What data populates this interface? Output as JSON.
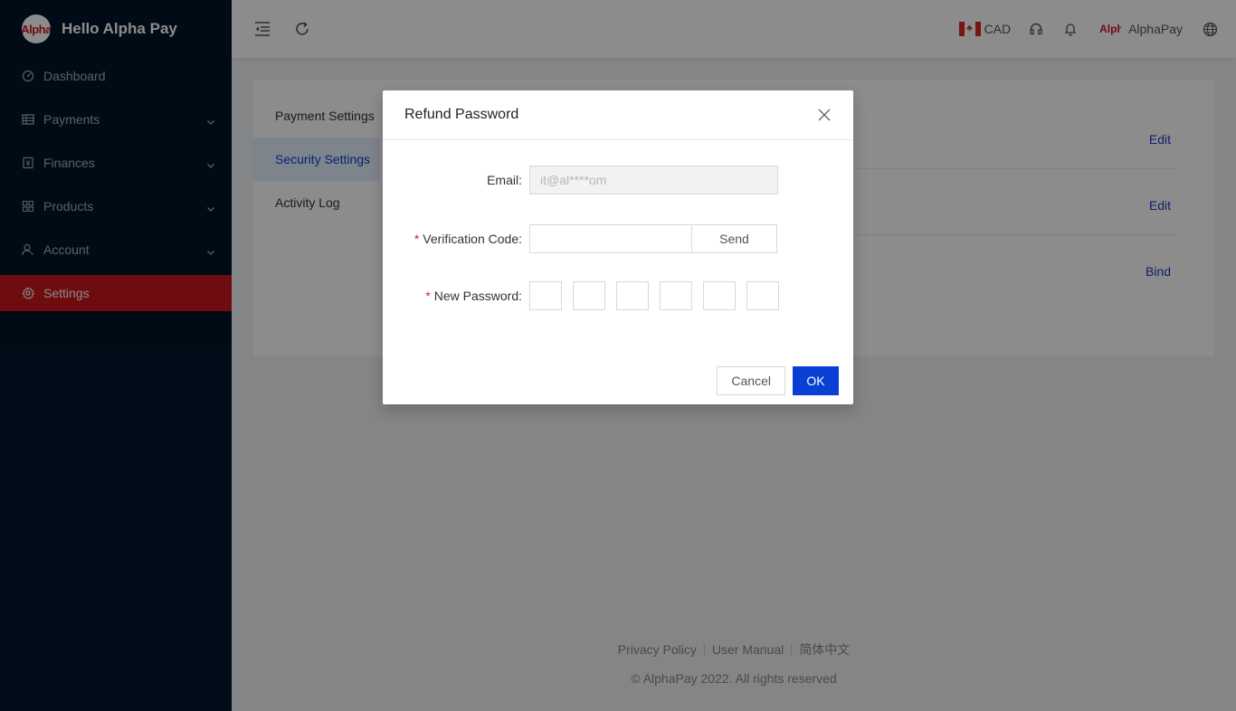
{
  "brand": {
    "logo_text": "Alpha",
    "title": "Hello Alpha Pay"
  },
  "sidebar": {
    "items": [
      {
        "label": "Dashboard",
        "icon": "dashboard-icon",
        "has_children": false,
        "active": false
      },
      {
        "label": "Payments",
        "icon": "table-icon",
        "has_children": true,
        "active": false
      },
      {
        "label": "Finances",
        "icon": "finance-icon",
        "has_children": true,
        "active": false
      },
      {
        "label": "Products",
        "icon": "product-icon",
        "has_children": true,
        "active": false
      },
      {
        "label": "Account",
        "icon": "account-icon",
        "has_children": true,
        "active": false
      },
      {
        "label": "Settings",
        "icon": "gear-icon",
        "has_children": false,
        "active": true
      }
    ]
  },
  "header": {
    "currency": "CAD",
    "user_logo_text": "Alpha",
    "user_name": "AlphaPay"
  },
  "content": {
    "tabs": [
      {
        "label": "Payment Settings"
      },
      {
        "label": "Security Settings"
      },
      {
        "label": "Activity Log"
      }
    ],
    "rows": [
      {
        "action": "Edit"
      },
      {
        "action": "Edit"
      },
      {
        "action": "Bind"
      }
    ]
  },
  "footer": {
    "links": [
      "Privacy Policy",
      "User Manual",
      "简体中文"
    ],
    "copyright": "© AlphaPay 2022. All rights reserved"
  },
  "modal": {
    "title": "Refund Password",
    "email_label": "Email:",
    "email_value": "it@al****om",
    "code_label": "Verification Code:",
    "code_value": "",
    "send_label": "Send",
    "password_label": "New Password:",
    "required_mark": "*",
    "cancel_label": "Cancel",
    "ok_label": "OK"
  },
  "colors": {
    "sidebar_bg": "#001529",
    "accent_red": "#c8161d",
    "primary_blue": "#0a3fd6"
  }
}
